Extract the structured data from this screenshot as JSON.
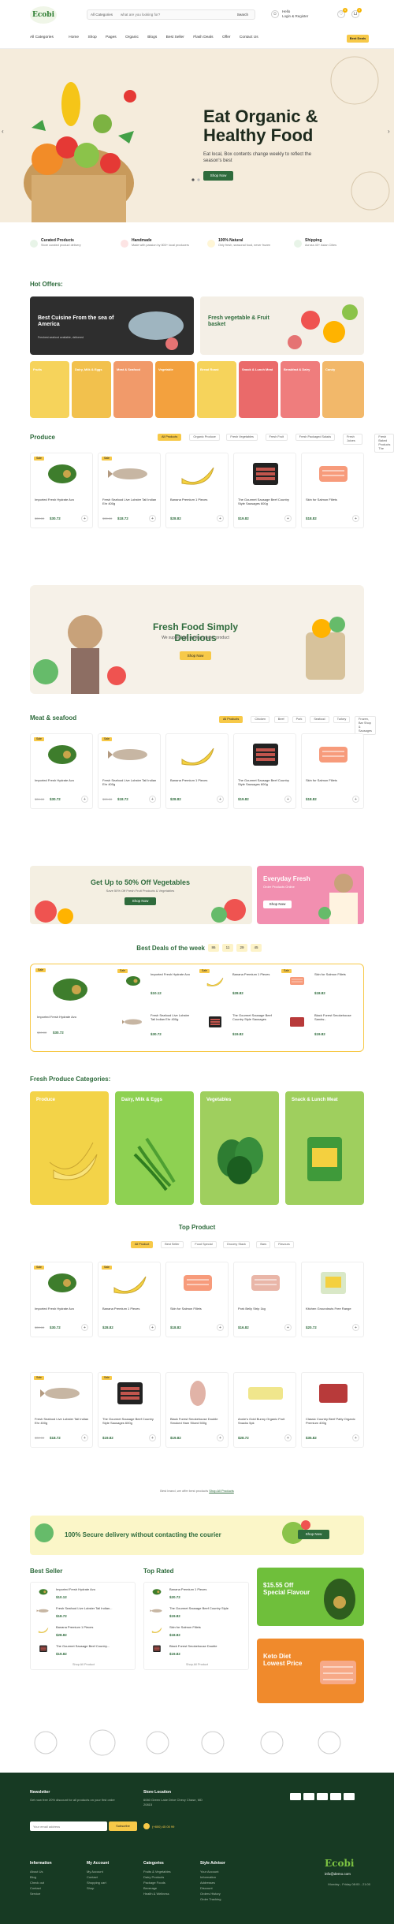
{
  "header": {
    "logo": "Ecobi",
    "search_category": "All Categories",
    "search_placeholder": "what are you looking for?",
    "search_button": "Search",
    "account_line1": "Hello",
    "account_line2": "Login & Register",
    "wishlist_count": "0",
    "cart_count": "0",
    "all_categories": "All Categories",
    "nav": [
      "Home",
      "Shop",
      "Pages",
      "Organic",
      "Blogs",
      "Best Seller",
      "Flash Deals",
      "Offer",
      "Contact Us"
    ],
    "right_button": "Best Deals"
  },
  "hero": {
    "title": "Eat Organic & Healthy Food",
    "subtitle": "Eat local, Box contents change weekly to reflect the season's best",
    "button": "Shop Now"
  },
  "features": [
    {
      "title": "Curated Products",
      "text": "Store curated product delivery",
      "icon": "basket-icon"
    },
    {
      "title": "Handmade",
      "text": "Made with passion by 800+ local producers",
      "icon": "hand-icon"
    },
    {
      "title": "100% Natural",
      "text": "Only fresh, seasonal food, never frozen",
      "icon": "leaf-icon"
    },
    {
      "title": "Shipping",
      "text": "Across 40+ Asian Cities",
      "icon": "truck-icon"
    }
  ],
  "hot_offers": {
    "title": "Hot Offers:",
    "banner1": "Best Cuisine From the sea of America",
    "banner1_sub": "Freshest seafood available, delivered",
    "banner2": "Fresh vegetable & Fruit basket",
    "categories": [
      "Fruits",
      "Dairy, Milk & Eggs",
      "Meat & Seafood",
      "Vegetable",
      "Bread Roast",
      "Snack & Lunch Meat",
      "Breakfast & Dairy",
      "Candy"
    ]
  },
  "produce": {
    "title": "Produce",
    "tabs": [
      "All Products",
      "Organic Produce",
      "Fresh Vegetables",
      "Fresh Fruit",
      "Fresh Packaged Salads",
      "Fresh Juices",
      "Fresh Baked Products The"
    ],
    "items": [
      {
        "name": "Imported Fresh Hydrate Avo",
        "old": "$39.00",
        "price": "$30.72"
      },
      {
        "name": "Fresh Seafood Live Lobster Tail Indian Ehr 400g",
        "old": "$30.00",
        "price": "$18.72"
      },
      {
        "name": "Banana Premium 1 Pieces",
        "old": "",
        "price": "$28.82"
      },
      {
        "name": "The Gourmet Sausage Beef Country Style Sausages 600g",
        "old": "",
        "price": "$19.82"
      },
      {
        "name": "Skin for Salmon Fillets",
        "old": "",
        "price": "$18.82"
      }
    ]
  },
  "promo_banner": {
    "title": "Fresh Food Simply Delicious",
    "sub": "We supply high quality organic product",
    "button": "Shop Now"
  },
  "meat": {
    "title": "Meat & seafood",
    "tabs": [
      "All Products",
      "Chicken",
      "Beef",
      "Pork",
      "Seafood",
      "Turkey",
      "Frozen, Bar Shop & Sausages"
    ],
    "items": [
      {
        "name": "Imported Fresh Hydrate Avo",
        "old": "$39.00",
        "price": "$30.72"
      },
      {
        "name": "Fresh Seafood Live Lobster Tail Indian Ehr 400g",
        "old": "$30.00",
        "price": "$18.72"
      },
      {
        "name": "Banana Premium 1 Pieces",
        "old": "",
        "price": "$28.82"
      },
      {
        "name": "The Gourmet Sausage Beef Country Style Sausages 600g",
        "old": "",
        "price": "$19.82"
      },
      {
        "name": "Skin for Salmon Fillets",
        "old": "",
        "price": "$18.82"
      }
    ]
  },
  "deal_banners": {
    "left_title": "Get Up to 50% Off Vegetables",
    "left_sub": "Save 50% Off Fresh Fruit Products & Vegetables",
    "left_button": "Shop Now",
    "right_title": "Everyday Fresh",
    "right_sub": "Order Products Online",
    "right_button": "Shop Now"
  },
  "best_deals": {
    "title": "Best Deals of the week",
    "countdown": [
      "86",
      "11",
      "29",
      "45"
    ],
    "items": [
      {
        "name": "Imported Fresh Hydrate Avo",
        "old": "$39.00",
        "price": "$30.72"
      },
      {
        "name": "Imported Fresh Hydrate Avo",
        "old": "",
        "price": "$10.12"
      },
      {
        "name": "Banana Premium 1 Pieces",
        "old": "",
        "price": "$28.82"
      },
      {
        "name": "Skin for Salmon Fillets",
        "old": "",
        "price": "$18.82"
      },
      {
        "name": "Fresh Seafood Live Lobster Tail Indian Ehr 400g",
        "old": "",
        "price": "$30.72"
      },
      {
        "name": "The Gourmet Sausage Beef Country Style Sausages",
        "old": "",
        "price": "$19.82"
      },
      {
        "name": "Black Forest Smokehouse Sandw...",
        "old": "",
        "price": "$19.82"
      }
    ]
  },
  "fresh_categories": {
    "title": "Fresh Produce Categories:",
    "items": [
      "Produce",
      "Dairy, Milk & Eggs",
      "Vegetables",
      "Snack & Lunch Meat"
    ]
  },
  "top_product": {
    "title": "Top Product",
    "tabs": [
      "All Product",
      "Best Seller",
      "Food Special",
      "Grocery Stack",
      "Bars",
      "Flavours"
    ],
    "row1": [
      {
        "name": "Imported Fresh Hydrate Avo",
        "old": "$39.00",
        "price": "$30.72"
      },
      {
        "name": "Banana Premium 1 Pieces",
        "old": "",
        "price": "$28.82"
      },
      {
        "name": "Skin for Salmon Fillets",
        "old": "",
        "price": "$18.82"
      },
      {
        "name": "Pork Belly Strip 1kg",
        "old": "",
        "price": "$16.82"
      },
      {
        "name": "Kitchen Groundnuts Free Range",
        "old": "",
        "price": "$20.72"
      }
    ],
    "row2": [
      {
        "name": "Fresh Seafood Live Lobster Tail Indian Ehr 400g",
        "old": "$30.00",
        "price": "$18.72"
      },
      {
        "name": "The Gourmet Sausage Beef Country Style Sausages 600g",
        "old": "",
        "price": "$19.82"
      },
      {
        "name": "Black Forest Smokehouse Double Smoked Ham Sliced 500g",
        "old": "",
        "price": "$19.82"
      },
      {
        "name": "Annie's Gold Bunny Organic Fruit Snacks 5pk",
        "old": "",
        "price": "$28.72"
      },
      {
        "name": "Classic Country Beef Patty Organic Premium 400g",
        "old": "",
        "price": "$35.82"
      }
    ],
    "footer_text": "Best brand, we offer best products",
    "footer_link": "Shop All Products"
  },
  "secure_banner": {
    "title": "100% Secure delivery without contacting the courier",
    "button": "Shop Now"
  },
  "best_seller": {
    "title": "Best Seller",
    "items": [
      {
        "name": "Imported Fresh Hydrate Avo",
        "price": "$10.12"
      },
      {
        "name": "Fresh Seafood Live Lobster Tail Indian...",
        "price": "$18.72"
      },
      {
        "name": "Banana Premium 1 Pieces",
        "price": "$28.82"
      },
      {
        "name": "The Gourmet Sausage Beef Country...",
        "price": "$19.82"
      }
    ],
    "more": "Shop All Product"
  },
  "top_rated": {
    "title": "Top Rated",
    "items": [
      {
        "name": "Banana Premium 1 Pieces",
        "price": "$20.72"
      },
      {
        "name": "The Gourmet Sausage Beef Country Style",
        "price": "$19.82"
      },
      {
        "name": "Skin for Salmon Fillets",
        "price": "$18.82"
      },
      {
        "name": "Black Forest Smokehouse Double",
        "price": "$19.82"
      }
    ],
    "more": "Shop All Product"
  },
  "side_banners": {
    "top": "$15.55 Off Special Flavour",
    "bottom": "Keto Diet Lowest Price"
  },
  "footer": {
    "newsletter_title": "Newsletter",
    "newsletter_text": "Get now free 20% discount for all products on your first order",
    "email_placeholder": "Your email address",
    "subscribe": "Subscribe",
    "store_title": "Store Location",
    "store_text": "6060 Green Lake Drive Chevy Chase, MD 20815",
    "phone": "(+800) 45 00 99",
    "logo": "Ecobi",
    "email": "info@demo.com",
    "col1_title": "Information",
    "col1": [
      "About Us",
      "Blog",
      "Check out",
      "Contact",
      "Service"
    ],
    "col2_title": "My Account",
    "col2": [
      "My Account",
      "Contact",
      "Shopping cart",
      "Shop"
    ],
    "col3_title": "Categories",
    "col3": [
      "Fruits & Vegetables",
      "Dairy Products",
      "Package Foods",
      "Beverage",
      "Health & Wellness"
    ],
    "col4_title": "Style Advisor",
    "col4": [
      "Your Account",
      "Information",
      "Addresses",
      "Discount",
      "Orders History",
      "Order Tracking"
    ],
    "address_line": "Monday - Friday 08:00 - 21:00",
    "colors": {
      "brand_green": "#2e6b3c",
      "footer_bg": "#173a23",
      "accent_yellow": "#f7c948"
    }
  }
}
